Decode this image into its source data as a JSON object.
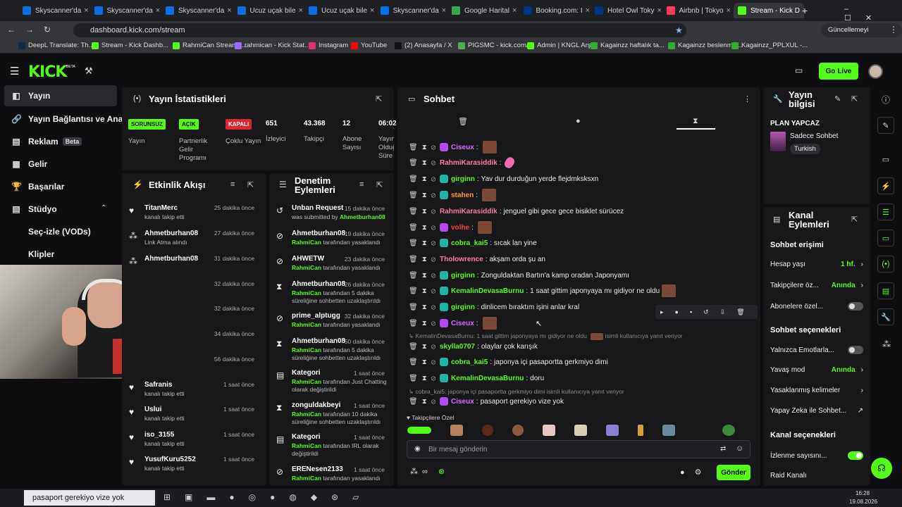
{
  "browser": {
    "tabs": [
      {
        "label": "Skyscanner'da",
        "color": "#0770e3"
      },
      {
        "label": "Skyscanner'da",
        "color": "#0770e3"
      },
      {
        "label": "Skyscanner'da",
        "color": "#0770e3"
      },
      {
        "label": "Ucuz uçak bile",
        "color": "#0770e3"
      },
      {
        "label": "Ucuz uçak bile",
        "color": "#0770e3"
      },
      {
        "label": "Skyscanner'da",
        "color": "#0770e3"
      },
      {
        "label": "Google Harital",
        "color": "#34a853"
      },
      {
        "label": "Booking.com: I",
        "color": "#003580"
      },
      {
        "label": "Hotel Owl Toky",
        "color": "#003580"
      },
      {
        "label": "Airbnb | Tokyo",
        "color": "#ff385c"
      },
      {
        "label": "Stream - Kick D",
        "color": "#53fc18"
      }
    ],
    "url": "dashboard.kick.com/stream",
    "update_label": "Güncellemeyi tamamla",
    "bookmarks": [
      "DeepL Translate: Th...",
      "Stream - Kick Dashb...",
      "RahmiCan Stream -...",
      "rahmican - Kick Stat...",
      "Instagram",
      "YouTube",
      "(2) Anasayfa / X",
      "PIGSMC - kick.com/...",
      "Admin | KNGL Arşiv",
      "Kagainzz haftalık ta...",
      "Kagainzz beslenme...",
      "Kagainzz_PPLXUL -..."
    ]
  },
  "kick": {
    "logo": "KICK",
    "logo_beta": "BETA",
    "go_live": "Go Live"
  },
  "nav": {
    "items": [
      "Yayın",
      "Yayın Bağlantısı ve Anahtarı",
      "Reklam",
      "Gelir",
      "Başarılar",
      "Stüdyo",
      "Seç-izle (VODs)",
      "Klipler"
    ],
    "beta": "Beta"
  },
  "stats": {
    "title": "Yayın İstatistikleri",
    "badges": [
      {
        "text": "SORUNSUZ",
        "label": "Yayın"
      },
      {
        "text": "AÇIK",
        "label": "Partnerlik Gelir Programı"
      },
      {
        "text": "KAPALI",
        "label": "Çoklu Yayın"
      }
    ],
    "numbers": [
      {
        "value": "651",
        "label": "İzleyici"
      },
      {
        "value": "43.368",
        "label": "Takipçi"
      },
      {
        "value": "12",
        "label": "Abone Sayısı"
      },
      {
        "value": "06:02",
        "label": "Yayın Olduğu Süre"
      }
    ]
  },
  "activity": {
    "title": "Etkinlik Akışı",
    "items": [
      {
        "name": "TitanMerc",
        "time": "25 dakika önce",
        "sub": "kanalı takip etti",
        "icon": "heart-icon"
      },
      {
        "name": "Ahmetburhan08",
        "time": "27 dakika önce",
        "sub": "Link Atma alındı",
        "icon": "gift-icon"
      },
      {
        "name": "Ahmetburhan08",
        "time": "31 dakika önce",
        "sub": "",
        "icon": "gift-icon"
      },
      {
        "name": "",
        "time": "32 dakika önce",
        "sub": "",
        "icon": ""
      },
      {
        "name": "",
        "time": "32 dakika önce",
        "sub": "",
        "icon": ""
      },
      {
        "name": "",
        "time": "34 dakika önce",
        "sub": "",
        "icon": ""
      },
      {
        "name": "",
        "time": "56 dakika önce",
        "sub": "",
        "icon": ""
      },
      {
        "name": "Safranis",
        "time": "1 saat önce",
        "sub": "kanalı takip etti",
        "icon": "heart-icon"
      },
      {
        "name": "Uslui",
        "time": "1 saat önce",
        "sub": "kanalı takip etti",
        "icon": "heart-icon"
      },
      {
        "name": "iso_3155",
        "time": "1 saat önce",
        "sub": "kanalı takip etti",
        "icon": "heart-icon"
      },
      {
        "name": "YusufKuru5252",
        "time": "1 saat önce",
        "sub": "kanalı takip etti",
        "icon": "heart-icon"
      }
    ]
  },
  "moderation": {
    "title": "Denetim Eylemleri",
    "items": [
      {
        "name": "Unban Request",
        "time": "15 dakika önce",
        "l1a": "was submitted by ",
        "l1b": "Ahmetburhan08",
        "l2": "",
        "icon": "unban-icon"
      },
      {
        "name": "Ahmetburhan08",
        "time": "19 dakika önce",
        "l1a": "RahmiCan",
        "l1b": " tarafından yasaklandı",
        "l2": "",
        "icon": "ban-icon"
      },
      {
        "name": "AHWETW",
        "time": "23 dakika önce",
        "l1a": "RahmiCan",
        "l1b": " tarafından yasaklandı",
        "l2": "",
        "icon": "ban-icon"
      },
      {
        "name": "Ahmetburhan08",
        "time": "26 dakika önce",
        "l1a": "RahmiCan",
        "l1b": " tarafından 5 dakika",
        "l2": "süreliğine sohbetten uzaklaştırıldı",
        "icon": "hourglass-icon"
      },
      {
        "name": "prime_alptugg",
        "time": "32 dakika önce",
        "l1a": "RahmiCan",
        "l1b": " tarafından yasaklandı",
        "l2": "",
        "icon": "ban-icon"
      },
      {
        "name": "Ahmetburhan08",
        "time": "50 dakika önce",
        "l1a": "RahmiCan",
        "l1b": " tarafından 5 dakika",
        "l2": "süreliğine sohbetten uzaklaştırıldı",
        "icon": "hourglass-icon"
      },
      {
        "name": "Kategori",
        "time": "1 saat önce",
        "l1a": "RahmiCan",
        "l1b": " tarafından Just Chatting",
        "l2": "olarak değiştirildi",
        "icon": "category-icon"
      },
      {
        "name": "zonguldakbeyi",
        "time": "1 saat önce",
        "l1a": "RahmiCan",
        "l1b": " tarafından 10 dakika",
        "l2": "süreliğine sohbetten uzaklaştırıldı",
        "icon": "hourglass-icon"
      },
      {
        "name": "Kategori",
        "time": "1 saat önce",
        "l1a": "RahmiCan",
        "l1b": " tarafından IRL olarak",
        "l2": "değiştirildi",
        "icon": "category-icon"
      },
      {
        "name": "ERENesen2133",
        "time": "1 saat önce",
        "l1a": "RahmiCan",
        "l1b": " tarafından yasaklandı",
        "l2": "",
        "icon": "ban-icon"
      }
    ]
  },
  "chat": {
    "title": "Sohbet",
    "messages": [
      {
        "user": "Ciseux",
        "color": "#d86bff",
        "badge": "#b04cf0",
        "text": "",
        "emote": true
      },
      {
        "user": "RahmiKarasiddik",
        "color": "#ff7aa2",
        "badge": "",
        "text": "",
        "emote": false,
        "pink": true
      },
      {
        "user": "girginn",
        "color": "#53fc18",
        "badge": "#1fb5a6",
        "text": "Yav dur durduğun yerde flejdmksksxn",
        "emote": false
      },
      {
        "user": "stahen",
        "color": "#ff9f2e",
        "badge": "#1fb5a6",
        "text": "",
        "emote": true
      },
      {
        "user": "RahmiKarasiddik",
        "color": "#ff7aa2",
        "badge": "",
        "text": "jenguel gibi gece gece bisiklet sürücez",
        "emote": false
      },
      {
        "user": "volhe",
        "color": "#ff3b3b",
        "badge": "#b04cf0",
        "text": "",
        "emote": true
      },
      {
        "user": "cobra_kai5",
        "color": "#53fc18",
        "badge": "#1fb5a6",
        "text": "sıcak lan yine",
        "emote": false
      },
      {
        "user": "Tholowrence",
        "color": "#ff7aa2",
        "badge": "",
        "text": "akşam orda şu an",
        "emote": false
      },
      {
        "user": "girginn",
        "color": "#53fc18",
        "badge": "#1fb5a6",
        "text": "Zonguldaktan Bartın'a kamp oradan Japonyamı",
        "emote": false
      },
      {
        "user": "KemalinDevasaBurnu",
        "color": "#53fc18",
        "badge": "#1fb5a6",
        "text": "1 saat gittim japonyaya mı gidiyor ne oldu",
        "emote": true
      },
      {
        "user": "girginn",
        "color": "#53fc18",
        "badge": "#1fb5a6",
        "text": "dinlicem bıraktım işini anlar kral",
        "emote": false
      },
      {
        "user": "Ciseux",
        "color": "#d86bff",
        "badge": "#b04cf0",
        "text": "",
        "emote": true
      },
      {
        "user": "skylla0707",
        "color": "#53fc18",
        "badge": "",
        "text": "olaylar çok karışık",
        "emote": false
      },
      {
        "user": "cobra_kai5",
        "color": "#53fc18",
        "badge": "#1fb5a6",
        "text": "japonya içi pasaportta gerkmiyo dimi",
        "emote": false
      },
      {
        "user": "KemalinDevasaBurnu",
        "color": "#53fc18",
        "badge": "#1fb5a6",
        "text": "doru",
        "emote": false
      },
      {
        "user": "Ciseux",
        "color": "#d86bff",
        "badge": "#b04cf0",
        "text": "pasaport gerekiyo vize yok",
        "emote": false
      }
    ],
    "reply1": "KemalinDevasaBurnu: 1 saat gittim japonyaya mı gidiyor ne oldu",
    "reply1b": "isimli kullanıcıya yanıt veriyor",
    "reply2": "cobra_kai5: japonya içi pasaportta gerkmiyo dimi isimli kullanıcıya yanıt veriyor",
    "followers_label": "Takipçilere Özel",
    "placeholder": "Bir mesaj gönderin",
    "send": "Gönder"
  },
  "stream_info": {
    "title": "Yayın bilgisi",
    "stream_title": "PLAN YAPCAZ",
    "category": "Sadece Sohbet",
    "language": "Turkish"
  },
  "channel": {
    "title": "Kanal Eylemleri",
    "chat_access": "Sohbet erişimi",
    "account_age": "Hesap yaşı",
    "account_age_val": "1 hf.",
    "followers_only": "Takipçilere öz...",
    "followers_only_val": "Anında",
    "subs_only": "Abonelere özel...",
    "chat_options": "Sohbet seçenekleri",
    "emotes_only": "Yalnızca Emotlarla...",
    "slow_mode": "Yavaş mod",
    "slow_mode_val": "Anında",
    "banned_words": "Yasaklanmış kelimeler",
    "ai_chat": "Yapay Zeka ile Sohbet...",
    "channel_options": "Kanal seçenekleri",
    "viewer_count": "İzlenme sayısını...",
    "raid": "Raid Kanalı"
  },
  "taskbar": {
    "caption": "pasaport gerekiyo vize yok",
    "time": "16:28",
    "date": "19.08.2026"
  }
}
